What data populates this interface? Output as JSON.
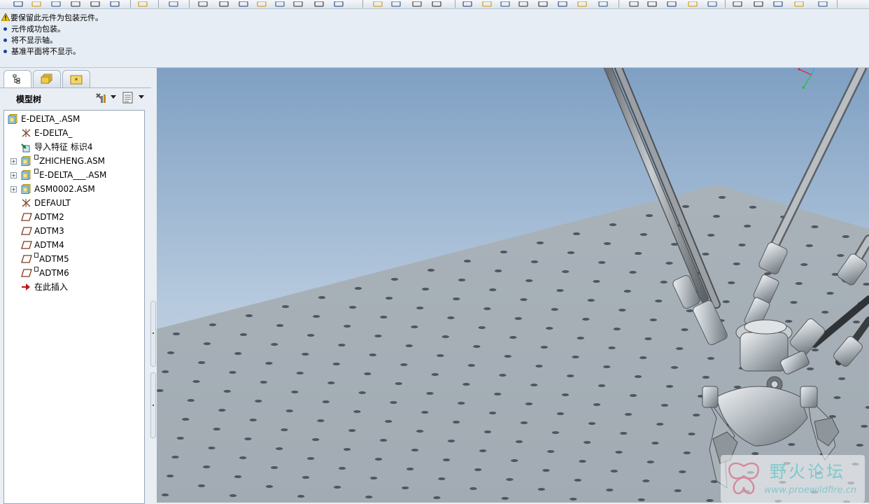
{
  "toolbar": {
    "icons": [
      "new-file-icon",
      "open-folder-icon",
      "save-icon",
      "print-icon",
      "email-icon",
      "link-icon",
      "undo-icon",
      "redo-icon",
      "cut-icon",
      "copy-icon",
      "paste-icon",
      "paste-special-icon",
      "regenerate-icon",
      "regen-manager-icon",
      "windows-icon",
      "select-icon",
      "repaint-icon",
      "spin-center-icon",
      "orient-icon",
      "shade-icon",
      "zoom-in-icon",
      "zoom-out-icon",
      "refit-icon",
      "reorient-icon",
      "saved-views-icon",
      "layers-icon",
      "appearance-icon",
      "wireframe-icon",
      "hidden-line-icon",
      "no-hidden-icon",
      "shading-icon",
      "enhanced-realism-icon",
      "datum-planes-icon",
      "datum-axes-icon",
      "datum-points-icon",
      "coordinate-systems-icon",
      "annotations-icon",
      "help-icon"
    ]
  },
  "messages": [
    {
      "type": "warning",
      "text": "要保留此元件为包装元件。"
    },
    {
      "type": "info",
      "text": "元件成功包装。"
    },
    {
      "type": "info",
      "text": "将不显示轴。"
    },
    {
      "type": "info",
      "text": "基准平面将不显示。"
    }
  ],
  "nav_tabs": [
    {
      "name": "model-tree-tab",
      "icon": "tree-icon",
      "active": true
    },
    {
      "name": "folder-browser-tab",
      "icon": "folder-stack-icon",
      "active": false
    },
    {
      "name": "favorites-tab",
      "icon": "favorites-folder-icon",
      "active": false
    }
  ],
  "model_tree": {
    "title": "模型树",
    "settings_icon": "tree-settings-icon",
    "show_icon": "tree-columns-icon",
    "items": [
      {
        "label": "E-DELTA_.ASM",
        "icon": "assembly-icon",
        "indent": 0,
        "expandable": false,
        "packaged": false
      },
      {
        "label": "E-DELTA_",
        "icon": "datum-csys-icon",
        "indent": 1,
        "expandable": false,
        "packaged": false
      },
      {
        "label": "导入特征 标识4",
        "icon": "import-feature-icon",
        "indent": 1,
        "expandable": false,
        "packaged": false
      },
      {
        "label": "ZHICHENG.ASM",
        "icon": "assembly-icon",
        "indent": 1,
        "expandable": true,
        "packaged": true
      },
      {
        "label": "E-DELTA___.ASM",
        "icon": "assembly-icon",
        "indent": 1,
        "expandable": true,
        "packaged": true
      },
      {
        "label": "ASM0002.ASM",
        "icon": "assembly-icon",
        "indent": 1,
        "expandable": true,
        "packaged": false
      },
      {
        "label": "DEFAULT",
        "icon": "datum-csys-icon",
        "indent": 1,
        "expandable": false,
        "packaged": false
      },
      {
        "label": "ADTM2",
        "icon": "datum-plane-icon",
        "indent": 1,
        "expandable": false,
        "packaged": false
      },
      {
        "label": "ADTM3",
        "icon": "datum-plane-icon",
        "indent": 1,
        "expandable": false,
        "packaged": false
      },
      {
        "label": "ADTM4",
        "icon": "datum-plane-icon",
        "indent": 1,
        "expandable": false,
        "packaged": false
      },
      {
        "label": "ADTM5",
        "icon": "datum-plane-icon",
        "indent": 1,
        "expandable": false,
        "packaged": true
      },
      {
        "label": "ADTM6",
        "icon": "datum-plane-icon",
        "indent": 1,
        "expandable": false,
        "packaged": true
      },
      {
        "label": "在此插入",
        "icon": "insert-here-arrow-icon",
        "indent": 1,
        "expandable": false,
        "packaged": false
      }
    ]
  },
  "viewport": {
    "scene": "delta-robot-on-perforated-table",
    "background_top": "#7fa0c3",
    "background_bottom": "#d2dde9",
    "table_color": "#a7b0b8"
  },
  "watermark": {
    "title": "野火论坛",
    "url": "www.proewildfire.cn"
  }
}
